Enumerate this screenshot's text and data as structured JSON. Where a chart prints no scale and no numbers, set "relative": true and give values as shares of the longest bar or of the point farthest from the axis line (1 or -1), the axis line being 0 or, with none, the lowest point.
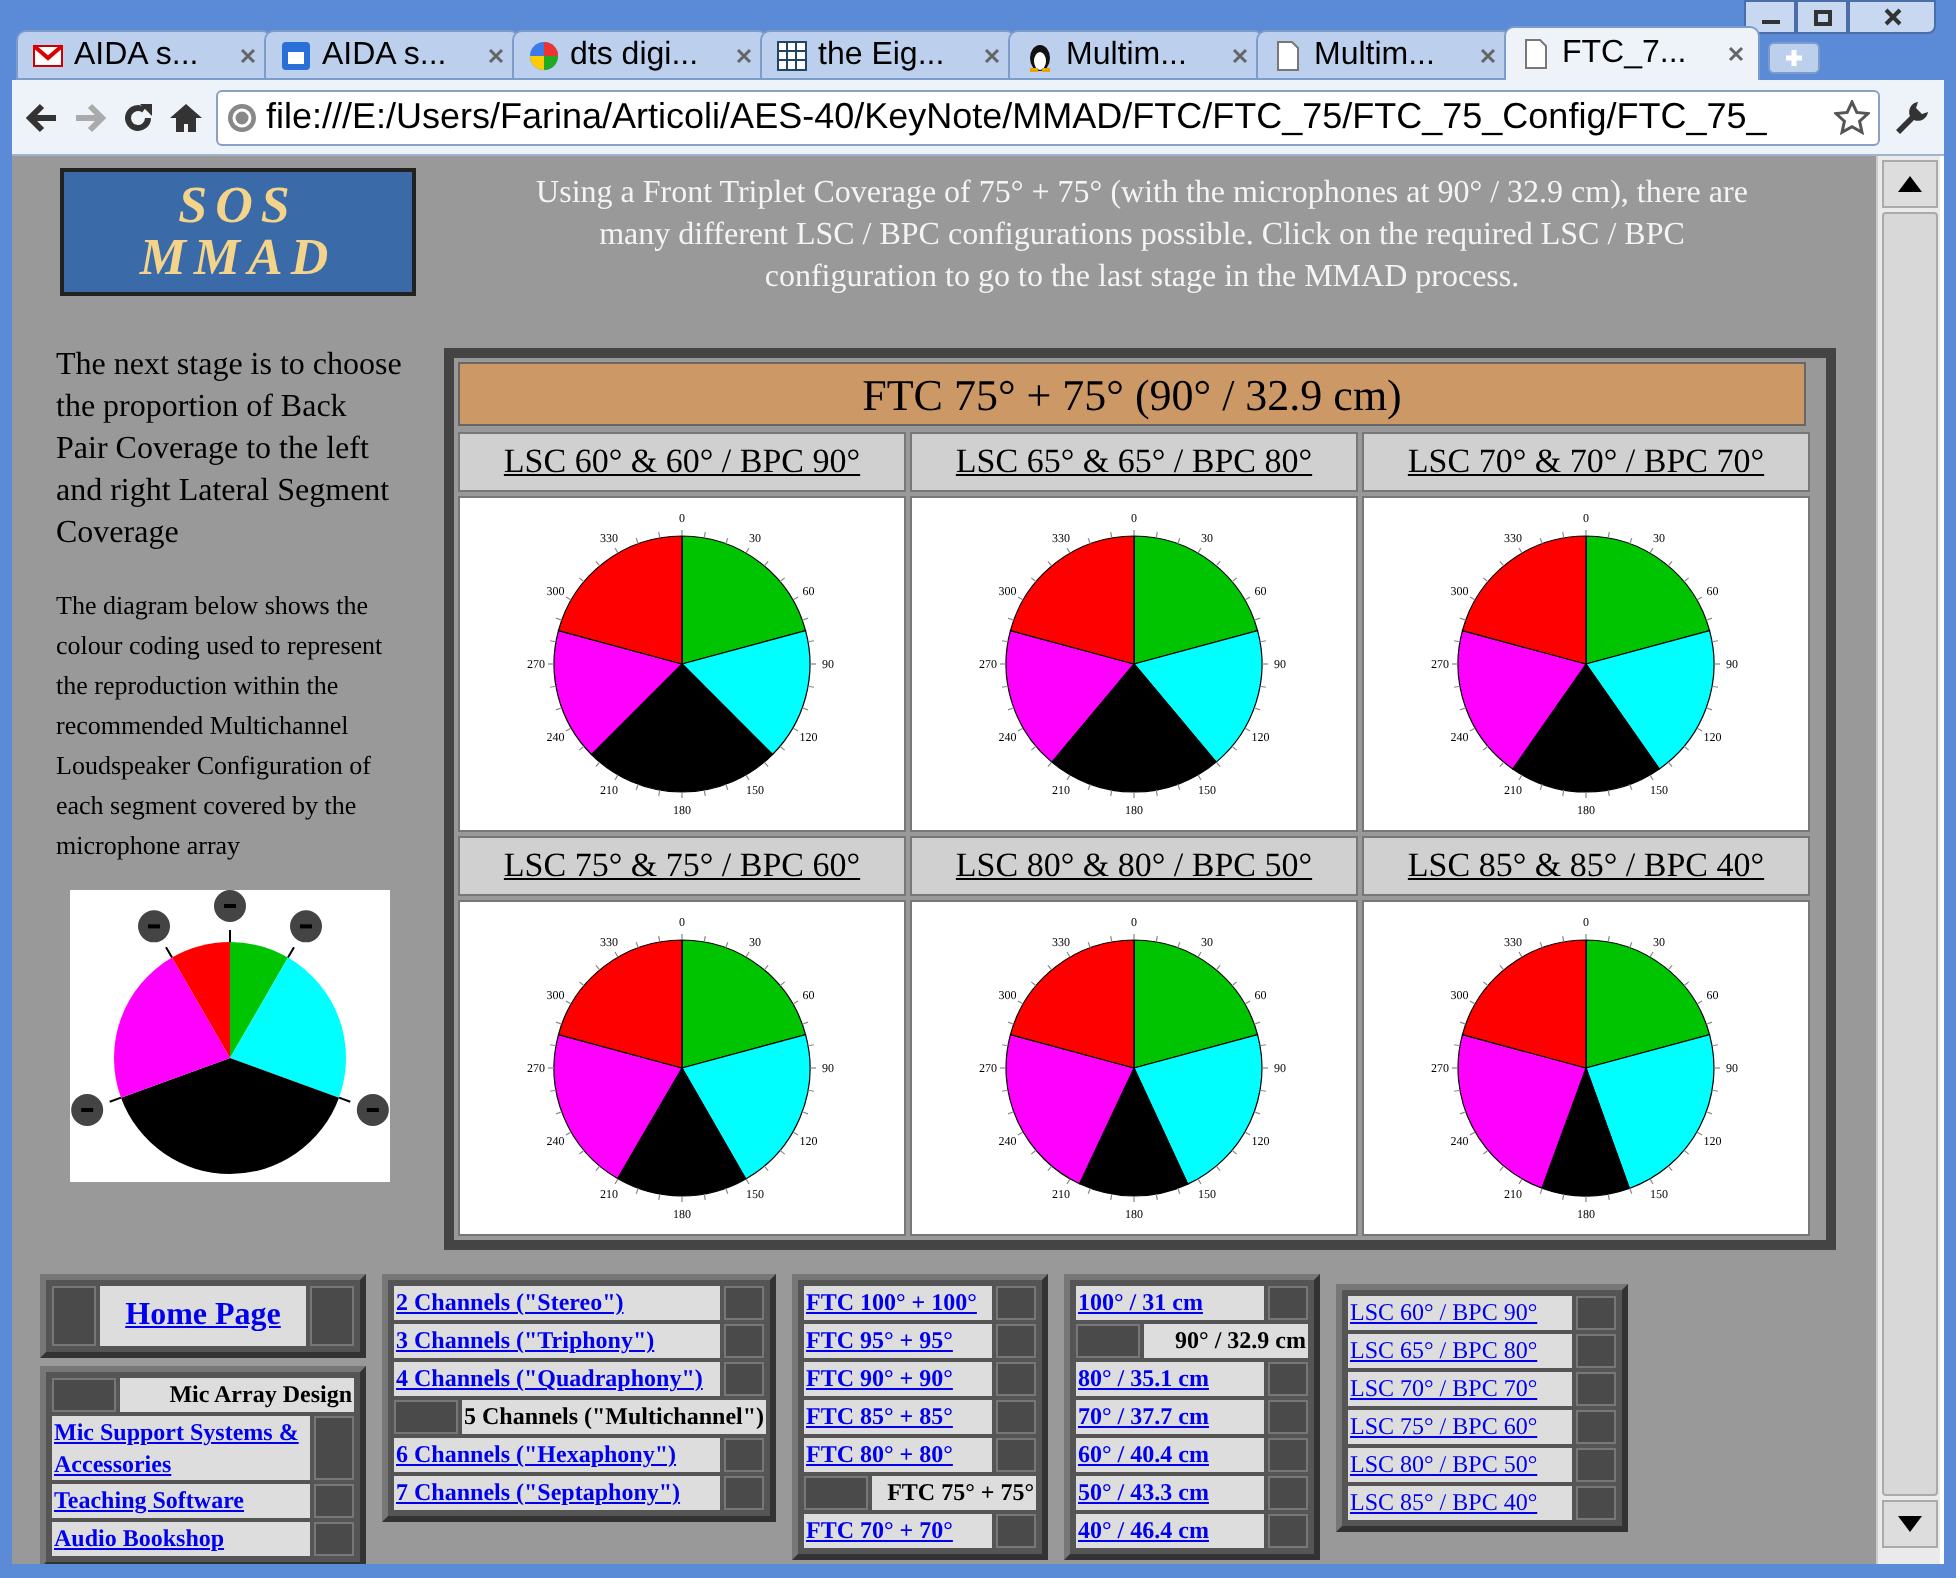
{
  "tabs": [
    {
      "label": "AIDA s...",
      "kind": "mail",
      "selected": false
    },
    {
      "label": "AIDA s...",
      "kind": "calendar",
      "selected": false
    },
    {
      "label": "dts digi...",
      "kind": "search",
      "selected": false
    },
    {
      "label": "the Eig...",
      "kind": "grid",
      "selected": false
    },
    {
      "label": "Multim...",
      "kind": "penguin",
      "selected": false
    },
    {
      "label": "Multim...",
      "kind": "page",
      "selected": false
    },
    {
      "label": "FTC_7...",
      "kind": "page",
      "selected": true
    }
  ],
  "address_bar": {
    "url": "file:///E:/Users/Farina/Articoli/AES-40/KeyNote/MMAD/FTC/FTC_75/FTC_75_Config/FTC_75_"
  },
  "page": {
    "logo": {
      "line_1": "SOS",
      "line_2": "MMAD"
    },
    "intro": "Using a Front Triplet Coverage of 75° + 75° (with the microphones at 90° / 32.9 cm), there are many different LSC / BPC configurations possible. Click on the required LSC / BPC configuration to go to the last stage in the MMAD process.",
    "sidebar_heading": "The next stage is to choose the proportion of Back Pair Coverage to the left and right Lateral Segment Coverage",
    "sidebar_text": "The diagram below shows the colour coding used to represent the reproduction within the recommended Multichannel Loudspeaker Configuration of each segment covered by the microphone array",
    "table_title": "FTC 75° + 75° (90° / 32.9 cm)",
    "configs": [
      {
        "label": "LSC 60° & 60° / BPC 90°",
        "angle_labels": [
          "0",
          "30",
          "60",
          "90",
          "120",
          "150",
          "180",
          "210",
          "240",
          "270",
          "300",
          "330"
        ],
        "chart_data": {
          "type": "pie",
          "relative": true,
          "values": [
            20.8,
            16.7,
            25.0,
            16.7,
            20.8
          ]
        }
      },
      {
        "label": "LSC 65° & 65° / BPC 80°",
        "angle_labels": [
          "0",
          "30",
          "60",
          "90",
          "120",
          "150",
          "180",
          "210",
          "240",
          "270",
          "300",
          "330"
        ],
        "chart_data": {
          "type": "pie",
          "relative": true,
          "values": [
            20.8,
            18.1,
            22.2,
            18.1,
            20.8
          ]
        }
      },
      {
        "label": "LSC 70° & 70° / BPC 70°",
        "angle_labels": [
          "0",
          "30",
          "60",
          "90",
          "120",
          "150",
          "180",
          "210",
          "240",
          "270",
          "300",
          "330"
        ],
        "chart_data": {
          "type": "pie",
          "relative": true,
          "values": [
            20.8,
            19.5,
            19.4,
            19.5,
            20.8
          ]
        }
      },
      {
        "label": "LSC 75° & 75° / BPC 60°",
        "angle_labels": [
          "0",
          "30",
          "60",
          "90",
          "120",
          "150",
          "180",
          "210",
          "240",
          "270",
          "300",
          "330"
        ],
        "chart_data": {
          "type": "pie",
          "relative": true,
          "values": [
            20.8,
            20.9,
            16.7,
            20.8,
            20.8
          ]
        }
      },
      {
        "label": "LSC 80° & 80° / BPC 50°",
        "angle_labels": [
          "0",
          "30",
          "60",
          "90",
          "120",
          "150",
          "180",
          "210",
          "240",
          "270",
          "300",
          "330"
        ],
        "chart_data": {
          "type": "pie",
          "relative": true,
          "values": [
            20.8,
            22.3,
            13.9,
            22.2,
            20.8
          ]
        }
      },
      {
        "label": "LSC 85° & 85° / BPC 40°",
        "angle_labels": [
          "0",
          "30",
          "60",
          "90",
          "120",
          "150",
          "180",
          "210",
          "240",
          "270",
          "300",
          "330"
        ],
        "chart_data": {
          "type": "pie",
          "relative": true,
          "values": [
            20.8,
            23.7,
            11.1,
            23.6,
            20.8
          ]
        }
      }
    ],
    "home_link": "Home Page",
    "nav_panels": [
      {
        "items": [
          {
            "label": "Mic Array Design",
            "selected": true
          },
          {
            "label": "Mic Support Systems & Accessories",
            "selected": false
          },
          {
            "label": "Teaching Software",
            "selected": false
          },
          {
            "label": "Audio Bookshop",
            "selected": false
          }
        ]
      },
      {
        "items": [
          {
            "label": "2 Channels (\"Stereo\")",
            "selected": false
          },
          {
            "label": "3 Channels (\"Triphony\")",
            "selected": false
          },
          {
            "label": "4 Channels (\"Quadraphony\")",
            "selected": false
          },
          {
            "label": "5 Channels (\"Multichannel\")",
            "selected": true
          },
          {
            "label": "6 Channels (\"Hexaphony\")",
            "selected": false
          },
          {
            "label": "7 Channels (\"Septaphony\")",
            "selected": false
          }
        ]
      },
      {
        "items": [
          {
            "label": "FTC 100° + 100°",
            "selected": false
          },
          {
            "label": "FTC 95° + 95°",
            "selected": false
          },
          {
            "label": "FTC 90° + 90°",
            "selected": false
          },
          {
            "label": "FTC 85° + 85°",
            "selected": false
          },
          {
            "label": "FTC 80° + 80°",
            "selected": false
          },
          {
            "label": "FTC 75° + 75°",
            "selected": true
          },
          {
            "label": "FTC 70° + 70°",
            "selected": false
          }
        ]
      },
      {
        "items": [
          {
            "label": "100° / 31 cm",
            "selected": false
          },
          {
            "label": "90° / 32.9 cm",
            "selected": true
          },
          {
            "label": "80° / 35.1 cm",
            "selected": false
          },
          {
            "label": "70° / 37.7 cm",
            "selected": false
          },
          {
            "label": "60° / 40.4 cm",
            "selected": false
          },
          {
            "label": "50° / 43.3 cm",
            "selected": false
          },
          {
            "label": "40° / 46.4 cm",
            "selected": false
          }
        ]
      },
      {
        "items": [
          {
            "label": "LSC 60° / BPC 90°",
            "selected": false
          },
          {
            "label": "LSC 65° / BPC 80°",
            "selected": false
          },
          {
            "label": "LSC 70° / BPC 70°",
            "selected": false
          },
          {
            "label": "LSC 75° / BPC 60°",
            "selected": false
          },
          {
            "label": "LSC 80° / BPC 50°",
            "selected": false
          },
          {
            "label": "LSC 85° / BPC 40°",
            "selected": false
          }
        ]
      }
    ]
  }
}
